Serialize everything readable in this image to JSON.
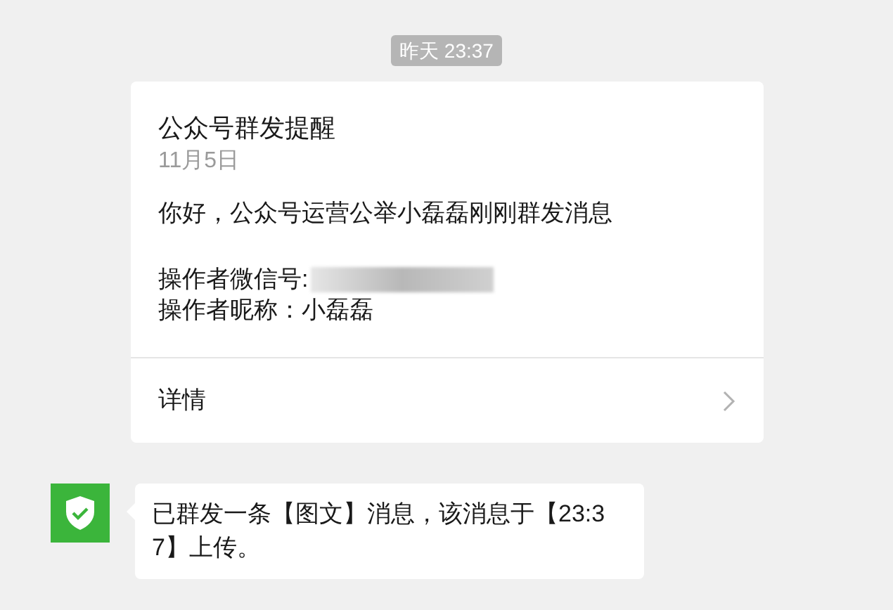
{
  "timestamp": "昨天 23:37",
  "card": {
    "title": "公众号群发提醒",
    "date": "11月5日",
    "greeting": "你好，公众号运营公举小磊磊刚刚群发消息",
    "fields": [
      {
        "label": "操作者微信号:",
        "redacted": true
      },
      {
        "label": "操作者昵称：",
        "value": "小磊磊",
        "redacted": false
      }
    ],
    "link": "详情"
  },
  "message": {
    "text": "已群发一条【图文】消息，该消息于【23:37】上传。"
  }
}
